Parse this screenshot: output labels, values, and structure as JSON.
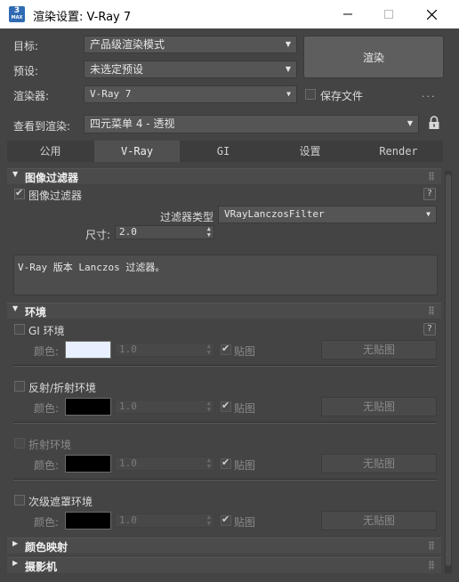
{
  "window": {
    "title": "渲染设置: V-Ray 7",
    "icon_label": "3",
    "icon_sub": "MAX",
    "icons": {
      "app": "3dsmax-app-icon",
      "minimize": "minimize-icon",
      "maximize": "maximize-icon",
      "close": "close-icon"
    }
  },
  "top": {
    "target_label": "目标:",
    "target_value": "产品级渲染模式",
    "preset_label": "预设:",
    "preset_value": "未选定预设",
    "renderer_label": "渲染器:",
    "renderer_value": "V-Ray 7",
    "save_file_label": "保存文件",
    "save_file_checked": false,
    "more_label": "...",
    "render_button": "渲染",
    "view_label": "查看到渲染:",
    "view_value": "四元菜单 4 - 透视",
    "lock_icon": "lock-icon"
  },
  "tabs": [
    {
      "label": "公用",
      "active": false
    },
    {
      "label": "V-Ray",
      "active": true
    },
    {
      "label": "GI",
      "active": false
    },
    {
      "label": "设置",
      "active": false
    },
    {
      "label": "Render Elements",
      "active": false
    }
  ],
  "image_filter": {
    "title": "图像过滤器",
    "expanded": true,
    "enable_label": "图像过滤器",
    "enabled": true,
    "help": "?",
    "type_label": "过滤器类型",
    "type_value": "VRayLanczosFilter",
    "size_label": "尺寸:",
    "size_value": "2.0",
    "description": "V-Ray 版本 Lanczos 过滤器。"
  },
  "environment": {
    "title": "环境",
    "expanded": true,
    "help": "?",
    "color_label": "颜色:",
    "map_label": "贴图",
    "no_map_label": "无贴图",
    "rows": [
      {
        "label": "GI 环境",
        "checked": false,
        "color": "#e8f0ff",
        "multiplier": "1.0",
        "map_checked": true
      },
      {
        "label": "反射/折射环境",
        "checked": false,
        "color": "#000000",
        "multiplier": "1.0",
        "map_checked": true
      },
      {
        "label": "折射环境",
        "checked": false,
        "color": "#000000",
        "multiplier": "1.0",
        "map_checked": true
      },
      {
        "label": "次级遮罩环境",
        "checked": false,
        "color": "#000000",
        "multiplier": "1.0",
        "map_checked": true
      }
    ]
  },
  "collapsed_rollouts": [
    {
      "title": "颜色映射"
    },
    {
      "title": "摄影机"
    }
  ],
  "colors": {
    "panel": "#444444",
    "titlebar": "#ffffff",
    "accent": "#2f6bb3"
  }
}
